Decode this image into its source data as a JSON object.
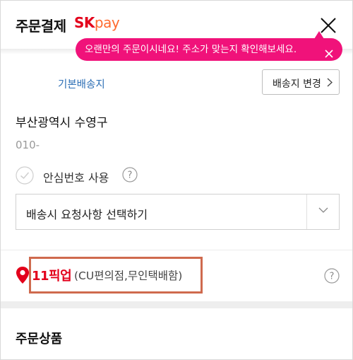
{
  "header": {
    "title": "주문결제",
    "brand_sk": "SK",
    "brand_pay": "pay"
  },
  "toast": {
    "message": "오랜만의 주문이시네요! 주소가 맞는지 확인해보세요."
  },
  "address": {
    "label": "기본배송지",
    "change_button": "배송지 변경",
    "line": "부산광역시 수영구",
    "phone": "010-"
  },
  "safe_number": {
    "label": "안심번호 사용"
  },
  "delivery_request": {
    "selected": "배송시 요청사항 선택하기"
  },
  "pickup": {
    "brand": "11픽업",
    "description": "(CU편의점,무인택배함)"
  },
  "products_section": {
    "title": "주문상품"
  },
  "colors": {
    "toast": "#f0127a",
    "brand_red": "#e3001b",
    "link_blue": "#2d6fb5",
    "highlight_border": "#cf6a4e"
  }
}
